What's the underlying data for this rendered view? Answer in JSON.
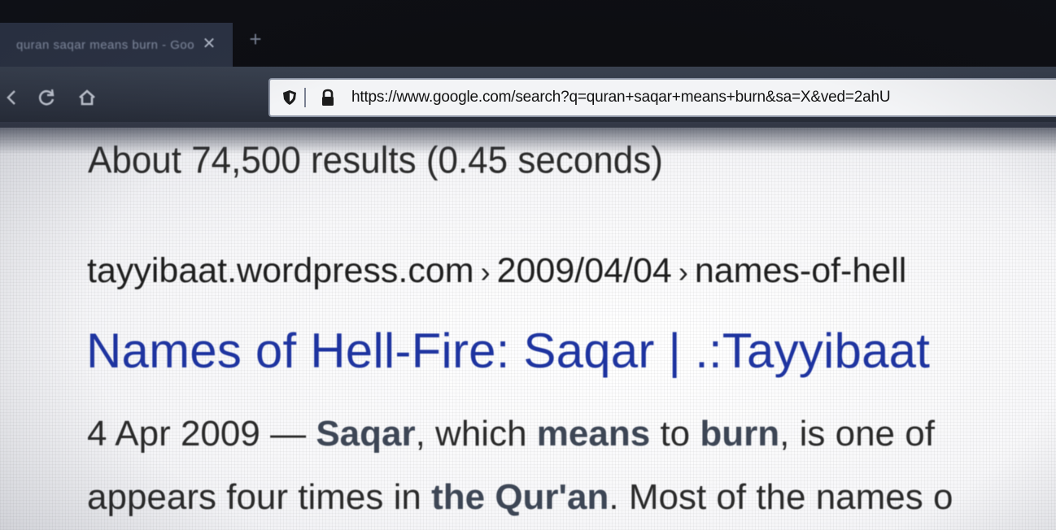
{
  "browser": {
    "tab": {
      "title": "quran saqar means burn - Goo",
      "close_icon": "close-icon"
    },
    "new_tab_icon": "plus-icon",
    "nav": {
      "back_icon": "arrow-left-icon",
      "reload_icon": "reload-icon",
      "home_icon": "home-icon"
    },
    "urlbar": {
      "shield_icon": "shield-icon",
      "lock_icon": "lock-icon",
      "url": "https://www.google.com/search?q=quran+saqar+means+burn&sa=X&ved=2ahU"
    }
  },
  "results": {
    "stats": "About 74,500 results (0.45 seconds)",
    "first": {
      "breadcrumb": {
        "domain": "tayyibaat.wordpress.com",
        "separator": "›",
        "path1": "2009/04/04",
        "path2": "names-of-hell"
      },
      "title": "Names of Hell-Fire: Saqar | .:Tayyibaat",
      "snippet": {
        "date": "4 Apr 2009 —",
        "w1": "Saqar",
        "t1": ", which",
        "w2": "means",
        "t2": "to",
        "w3": "burn",
        "t3": ", is one of",
        "t4": "appears four times in",
        "w4": "the Qur'an",
        "t5": ". Most of the names o"
      }
    }
  },
  "colors": {
    "link_title": "#1e34a0",
    "tab_bar": "#0d0e12",
    "nav_bar": "#2e3441"
  }
}
